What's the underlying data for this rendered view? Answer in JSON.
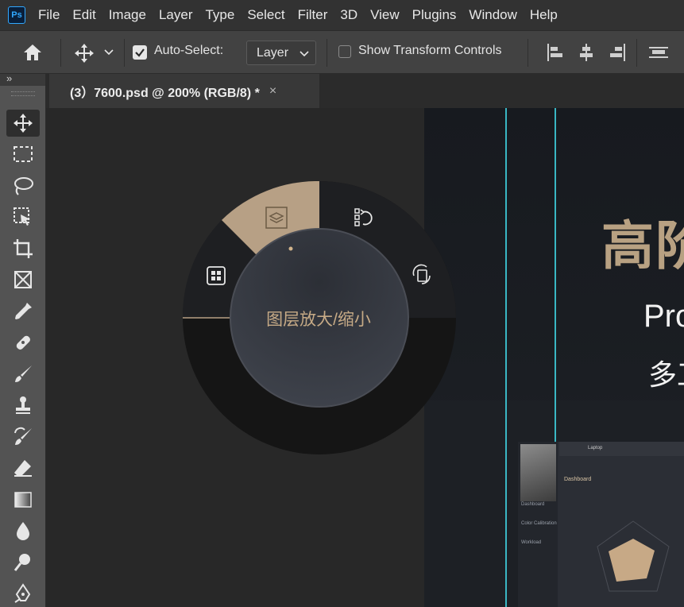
{
  "app": {
    "logo_text": "Ps"
  },
  "menu": [
    "File",
    "Edit",
    "Image",
    "Layer",
    "Type",
    "Select",
    "Filter",
    "3D",
    "View",
    "Plugins",
    "Window",
    "Help"
  ],
  "options": {
    "auto_select_label": "Auto-Select:",
    "auto_select_checked": true,
    "auto_select_target": "Layer",
    "show_transform_label": "Show Transform Controls",
    "show_transform_checked": false
  },
  "toolbar": {
    "collapse_glyph": "»",
    "tools": [
      "move-tool",
      "rectangular-marquee-tool",
      "lasso-tool",
      "object-selection-tool",
      "crop-tool",
      "frame-tool",
      "eyedropper-tool",
      "spot-healing-brush-tool",
      "brush-tool",
      "clone-stamp-tool",
      "history-brush-tool",
      "eraser-tool",
      "gradient-tool",
      "blur-tool",
      "dodge-tool",
      "pen-tool"
    ],
    "active_tool": "move-tool"
  },
  "document": {
    "tab_title": "(3）7600.psd @ 200% (RGB/8) *",
    "close_glyph": "×"
  },
  "radial_menu": {
    "center_label": "图层放大/缩小",
    "segments": [
      "layers-icon",
      "rotate-icon",
      "flip-icon",
      "grid-icon"
    ],
    "active_segment": "layers-icon",
    "accent_color": "#b7a085"
  },
  "canvas_content": {
    "heading_cn": "高阶",
    "heading_en": "Pro",
    "heading_cn2": "多工",
    "laptop_tab": "Laptop",
    "laptop_section": "Dashboard",
    "laptop_nav": [
      "Dashboard",
      "Color Calibration",
      "Workload"
    ]
  },
  "colors": {
    "guide": "#3fd2e0",
    "gold": "#b8a182"
  }
}
